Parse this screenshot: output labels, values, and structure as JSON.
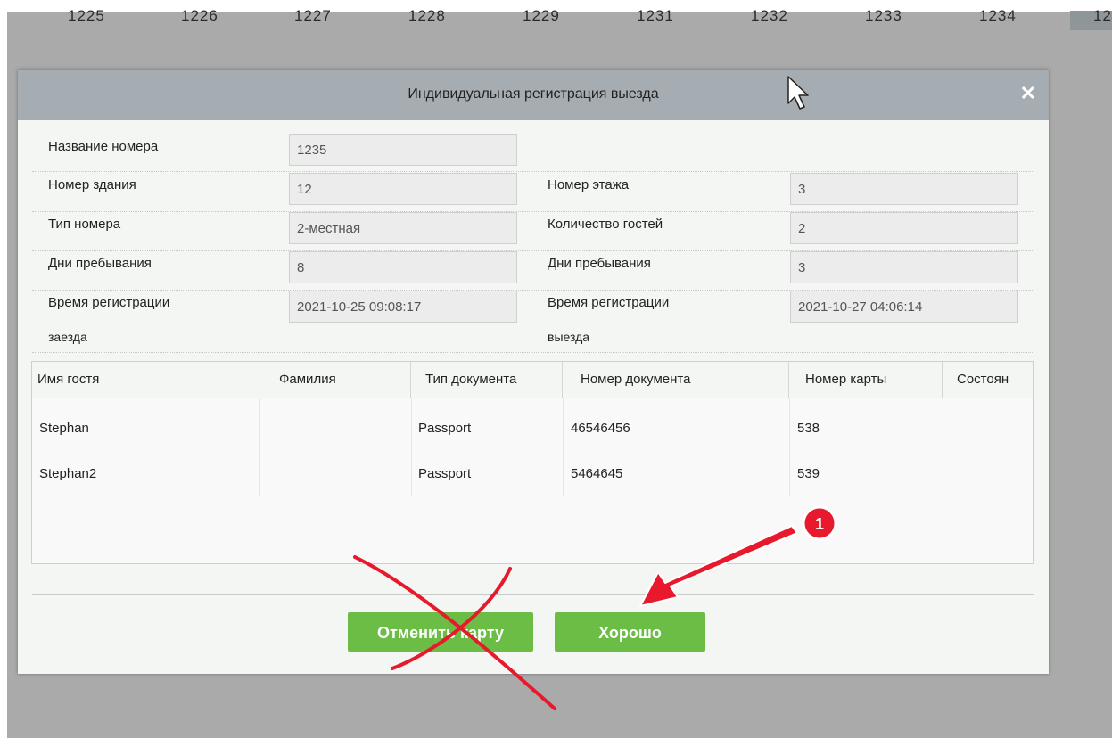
{
  "background": {
    "room_numbers": [
      "1225",
      "1226",
      "1227",
      "1228",
      "1229",
      "1231",
      "1232",
      "1233",
      "1234",
      "12"
    ]
  },
  "dialog": {
    "title": "Индивидуальная регистрация выезда",
    "close_icon": "close-icon",
    "fields": {
      "room_name": {
        "label": "Название номера",
        "value": "1235"
      },
      "building": {
        "label": "Номер здания",
        "value": "12"
      },
      "floor": {
        "label": "Номер этажа",
        "value": "3"
      },
      "room_type": {
        "label": "Тип номера",
        "value": "2-местная"
      },
      "guest_count": {
        "label": "Количество гостей",
        "value": "2"
      },
      "days_left": {
        "label": "Дни пребывания",
        "value": "8"
      },
      "days_right": {
        "label": "Дни пребывания",
        "value": "3"
      },
      "checkin": {
        "label_line1": "Время регистрации",
        "label_line2": "заезда",
        "value": "2021-10-25 09:08:17"
      },
      "checkout": {
        "label_line1": "Время регистрации",
        "label_line2": "выезда",
        "value": "2021-10-27 04:06:14"
      }
    },
    "guests": {
      "columns": [
        "Имя гостя",
        "Фамилия",
        "Тип документа",
        "Номер документа",
        "Номер карты",
        "Состоян"
      ],
      "rows": [
        [
          "Stephan",
          "",
          "Passport",
          "46546456",
          "538",
          ""
        ],
        [
          "Stephan2",
          "",
          "Passport",
          "5464645",
          "539",
          ""
        ]
      ]
    },
    "buttons": {
      "cancel_card": "Отменить карту",
      "ok": "Хорошо"
    }
  },
  "annotation": {
    "step_badge": "1",
    "colors": {
      "arrow": "#e8192c",
      "cross": "#e8192c",
      "button": "#6cbd45"
    }
  }
}
